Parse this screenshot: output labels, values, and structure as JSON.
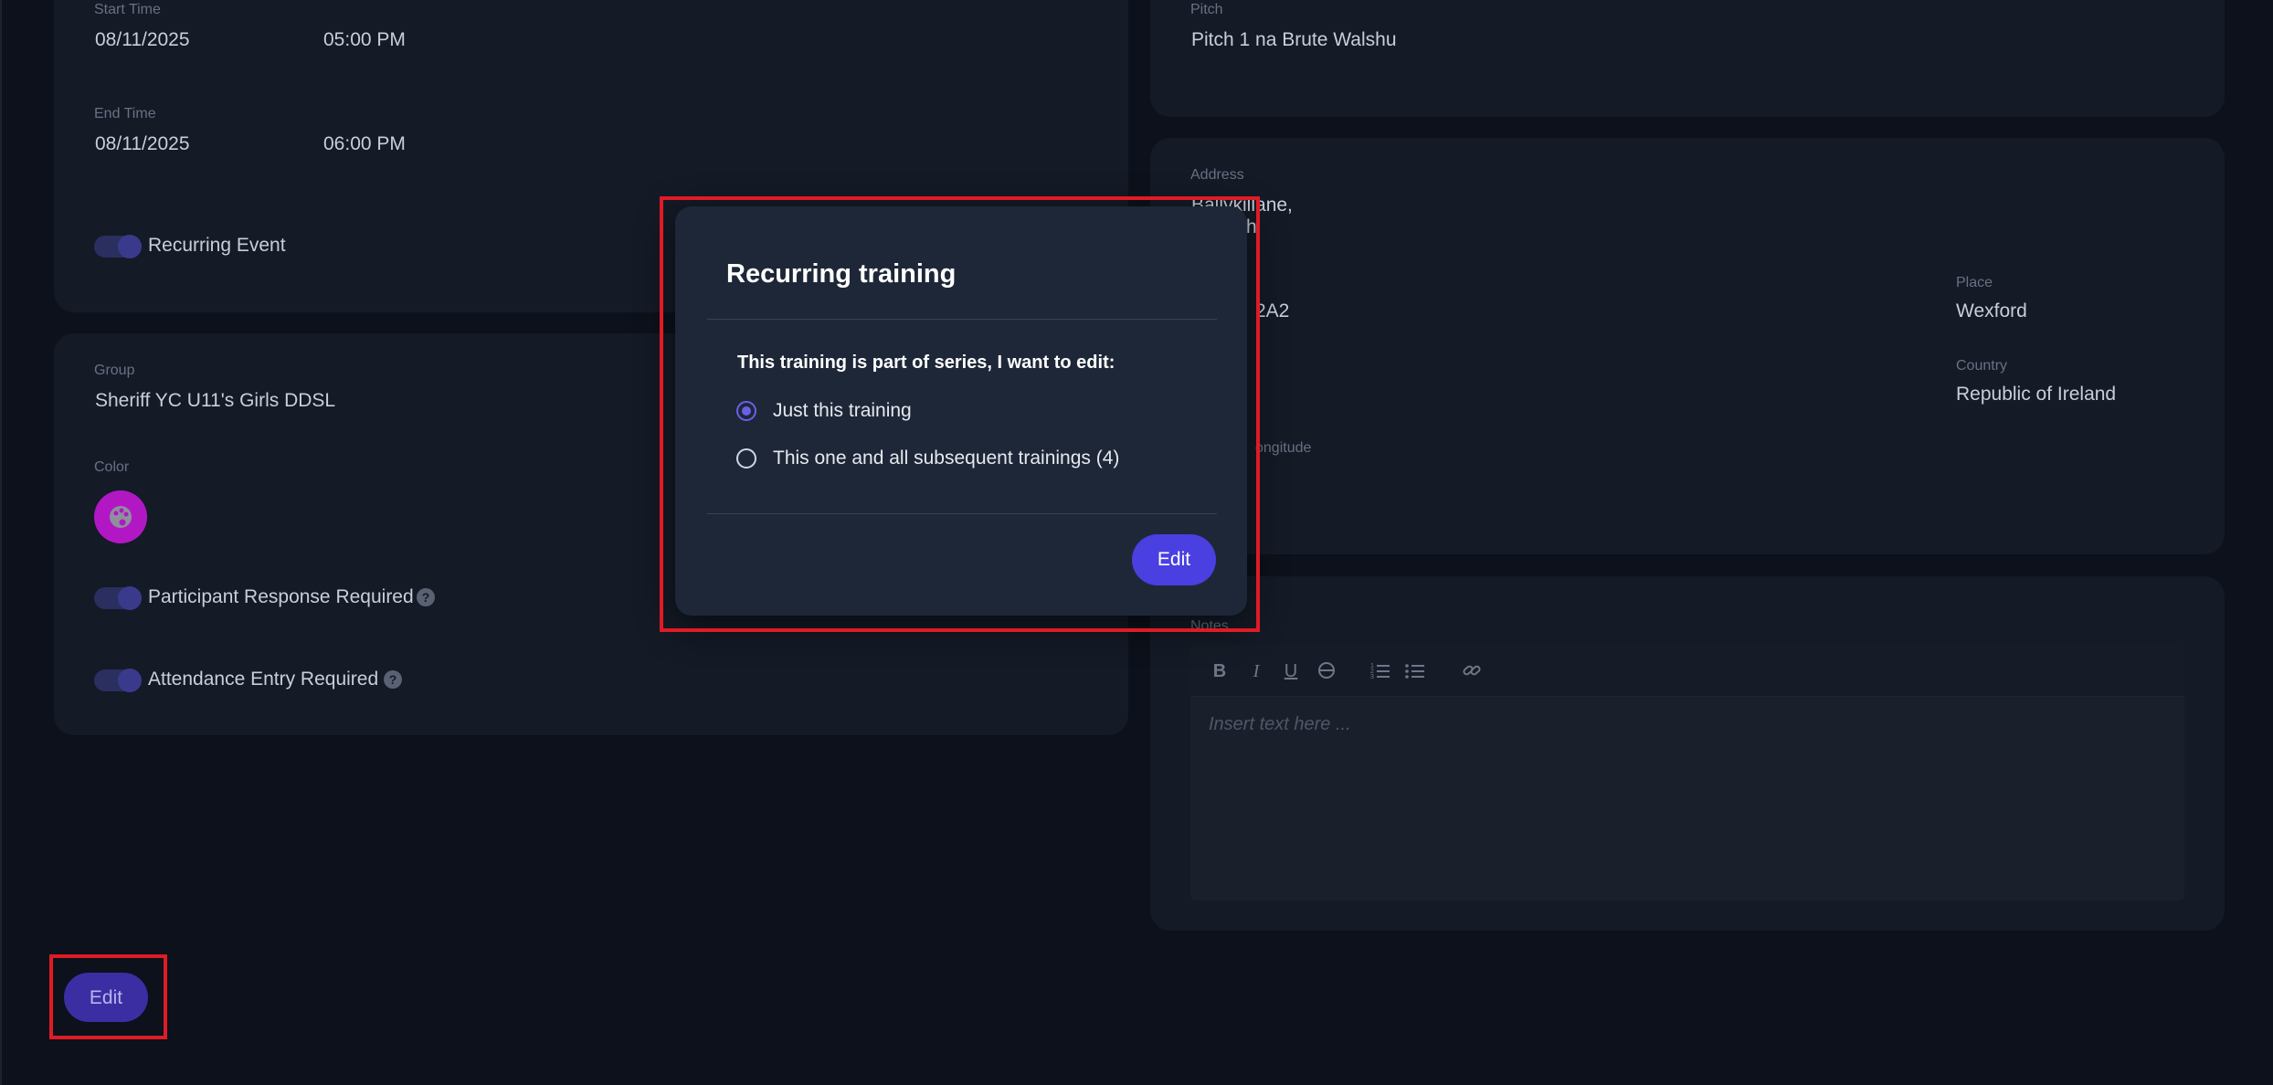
{
  "schedule": {
    "start_label": "Start Time",
    "start_date": "08/11/2025",
    "start_time": "05:00 PM",
    "end_label": "End Time",
    "end_date": "08/11/2025",
    "end_time": "06:00 PM",
    "recurring_label": "Recurring Event"
  },
  "group_card": {
    "group_label": "Group",
    "group_value": "Sheriff YC U11's Girls DDSL",
    "color_label": "Color",
    "color_value": "#b118c4",
    "participant_label": "Participant Response Required",
    "attendance_label": "Attendance Entry Required"
  },
  "pitch_card": {
    "pitch_label": "Pitch",
    "pitch_value": "Pitch 1 na Brute Walshu"
  },
  "address_card": {
    "address_label": "Address",
    "address_line1": "Ballykillane,",
    "address_line2": "h",
    "eircode_value": "2A2",
    "place_label": "Place",
    "place_value": "Wexford",
    "country_label": "Country",
    "country_value": "Republic of Ireland",
    "latlong_label": "ongitude"
  },
  "notes_card": {
    "notes_label": "Notes",
    "placeholder": "Insert text here ..."
  },
  "footer": {
    "edit_label": "Edit"
  },
  "modal": {
    "title": "Recurring training",
    "question": "This training is part of series, I want to edit:",
    "options": [
      {
        "label": "Just this training",
        "checked": true
      },
      {
        "label": "This one and all subsequent trainings  (4)",
        "checked": false
      }
    ],
    "edit_label": "Edit"
  },
  "colors": {
    "accent": "#4a3fe0",
    "highlight": "#e01b24"
  }
}
